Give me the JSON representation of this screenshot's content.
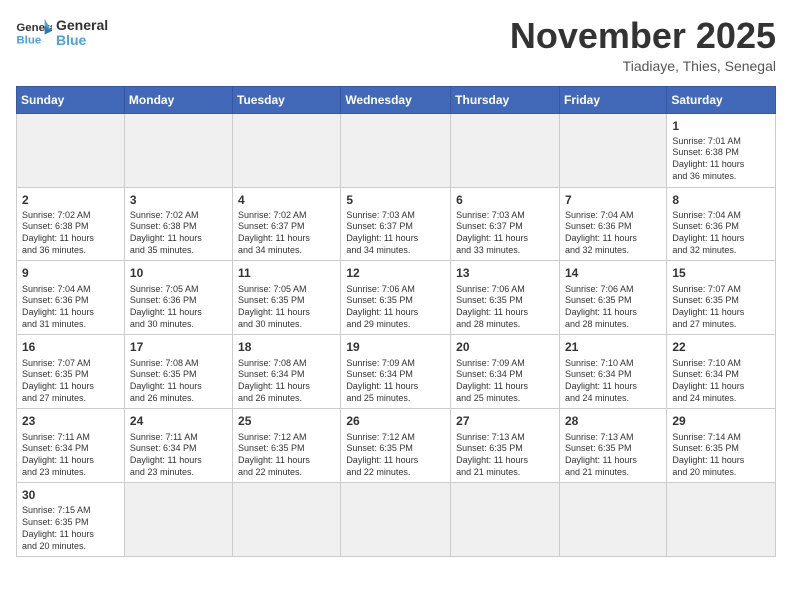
{
  "header": {
    "logo_general": "General",
    "logo_blue": "Blue",
    "month_title": "November 2025",
    "location": "Tiadiaye, Thies, Senegal"
  },
  "weekdays": [
    "Sunday",
    "Monday",
    "Tuesday",
    "Wednesday",
    "Thursday",
    "Friday",
    "Saturday"
  ],
  "weeks": [
    [
      {
        "day": "",
        "info": ""
      },
      {
        "day": "",
        "info": ""
      },
      {
        "day": "",
        "info": ""
      },
      {
        "day": "",
        "info": ""
      },
      {
        "day": "",
        "info": ""
      },
      {
        "day": "",
        "info": ""
      },
      {
        "day": "1",
        "info": "Sunrise: 7:01 AM\nSunset: 6:38 PM\nDaylight: 11 hours\nand 36 minutes."
      }
    ],
    [
      {
        "day": "2",
        "info": "Sunrise: 7:02 AM\nSunset: 6:38 PM\nDaylight: 11 hours\nand 36 minutes."
      },
      {
        "day": "3",
        "info": "Sunrise: 7:02 AM\nSunset: 6:38 PM\nDaylight: 11 hours\nand 35 minutes."
      },
      {
        "day": "4",
        "info": "Sunrise: 7:02 AM\nSunset: 6:37 PM\nDaylight: 11 hours\nand 34 minutes."
      },
      {
        "day": "5",
        "info": "Sunrise: 7:03 AM\nSunset: 6:37 PM\nDaylight: 11 hours\nand 34 minutes."
      },
      {
        "day": "6",
        "info": "Sunrise: 7:03 AM\nSunset: 6:37 PM\nDaylight: 11 hours\nand 33 minutes."
      },
      {
        "day": "7",
        "info": "Sunrise: 7:04 AM\nSunset: 6:36 PM\nDaylight: 11 hours\nand 32 minutes."
      },
      {
        "day": "8",
        "info": "Sunrise: 7:04 AM\nSunset: 6:36 PM\nDaylight: 11 hours\nand 32 minutes."
      }
    ],
    [
      {
        "day": "9",
        "info": "Sunrise: 7:04 AM\nSunset: 6:36 PM\nDaylight: 11 hours\nand 31 minutes."
      },
      {
        "day": "10",
        "info": "Sunrise: 7:05 AM\nSunset: 6:36 PM\nDaylight: 11 hours\nand 30 minutes."
      },
      {
        "day": "11",
        "info": "Sunrise: 7:05 AM\nSunset: 6:35 PM\nDaylight: 11 hours\nand 30 minutes."
      },
      {
        "day": "12",
        "info": "Sunrise: 7:06 AM\nSunset: 6:35 PM\nDaylight: 11 hours\nand 29 minutes."
      },
      {
        "day": "13",
        "info": "Sunrise: 7:06 AM\nSunset: 6:35 PM\nDaylight: 11 hours\nand 28 minutes."
      },
      {
        "day": "14",
        "info": "Sunrise: 7:06 AM\nSunset: 6:35 PM\nDaylight: 11 hours\nand 28 minutes."
      },
      {
        "day": "15",
        "info": "Sunrise: 7:07 AM\nSunset: 6:35 PM\nDaylight: 11 hours\nand 27 minutes."
      }
    ],
    [
      {
        "day": "16",
        "info": "Sunrise: 7:07 AM\nSunset: 6:35 PM\nDaylight: 11 hours\nand 27 minutes."
      },
      {
        "day": "17",
        "info": "Sunrise: 7:08 AM\nSunset: 6:35 PM\nDaylight: 11 hours\nand 26 minutes."
      },
      {
        "day": "18",
        "info": "Sunrise: 7:08 AM\nSunset: 6:34 PM\nDaylight: 11 hours\nand 26 minutes."
      },
      {
        "day": "19",
        "info": "Sunrise: 7:09 AM\nSunset: 6:34 PM\nDaylight: 11 hours\nand 25 minutes."
      },
      {
        "day": "20",
        "info": "Sunrise: 7:09 AM\nSunset: 6:34 PM\nDaylight: 11 hours\nand 25 minutes."
      },
      {
        "day": "21",
        "info": "Sunrise: 7:10 AM\nSunset: 6:34 PM\nDaylight: 11 hours\nand 24 minutes."
      },
      {
        "day": "22",
        "info": "Sunrise: 7:10 AM\nSunset: 6:34 PM\nDaylight: 11 hours\nand 24 minutes."
      }
    ],
    [
      {
        "day": "23",
        "info": "Sunrise: 7:11 AM\nSunset: 6:34 PM\nDaylight: 11 hours\nand 23 minutes."
      },
      {
        "day": "24",
        "info": "Sunrise: 7:11 AM\nSunset: 6:34 PM\nDaylight: 11 hours\nand 23 minutes."
      },
      {
        "day": "25",
        "info": "Sunrise: 7:12 AM\nSunset: 6:35 PM\nDaylight: 11 hours\nand 22 minutes."
      },
      {
        "day": "26",
        "info": "Sunrise: 7:12 AM\nSunset: 6:35 PM\nDaylight: 11 hours\nand 22 minutes."
      },
      {
        "day": "27",
        "info": "Sunrise: 7:13 AM\nSunset: 6:35 PM\nDaylight: 11 hours\nand 21 minutes."
      },
      {
        "day": "28",
        "info": "Sunrise: 7:13 AM\nSunset: 6:35 PM\nDaylight: 11 hours\nand 21 minutes."
      },
      {
        "day": "29",
        "info": "Sunrise: 7:14 AM\nSunset: 6:35 PM\nDaylight: 11 hours\nand 20 minutes."
      }
    ],
    [
      {
        "day": "30",
        "info": "Sunrise: 7:15 AM\nSunset: 6:35 PM\nDaylight: 11 hours\nand 20 minutes."
      },
      {
        "day": "",
        "info": ""
      },
      {
        "day": "",
        "info": ""
      },
      {
        "day": "",
        "info": ""
      },
      {
        "day": "",
        "info": ""
      },
      {
        "day": "",
        "info": ""
      },
      {
        "day": "",
        "info": ""
      }
    ]
  ]
}
